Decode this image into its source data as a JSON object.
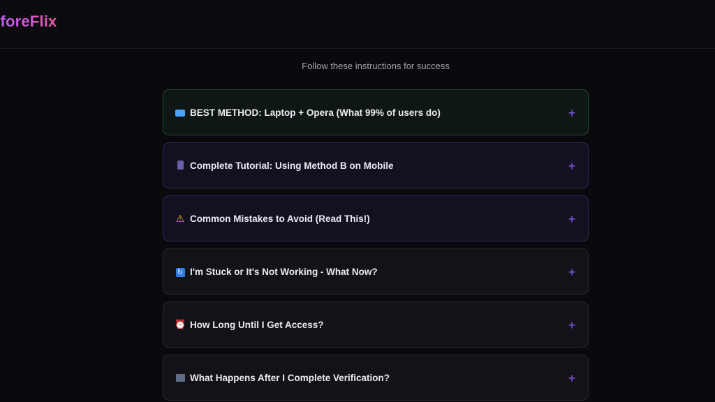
{
  "header": {
    "logo_text": "eforeFlix"
  },
  "page": {
    "subtitle": "Follow these instructions for success"
  },
  "faq": {
    "items": [
      {
        "icon": "laptop-icon",
        "question": "BEST METHOD: Laptop + Opera (What 99% of users do)",
        "toggle": "+"
      },
      {
        "icon": "mobile-phone-icon",
        "question": "Complete Tutorial: Using Method B on Mobile",
        "toggle": "+"
      },
      {
        "icon": "warning-icon",
        "question": "Common Mistakes to Avoid (Read This!)",
        "toggle": "+"
      },
      {
        "icon": "refresh-icon",
        "question": "I'm Stuck or It's Not Working - What Now?",
        "toggle": "+"
      },
      {
        "icon": "alarm-clock-icon",
        "question": "How Long Until I Get Access?",
        "toggle": "+"
      },
      {
        "icon": "clapperboard-icon",
        "question": "What Happens After I Complete Verification?",
        "toggle": "+"
      }
    ]
  },
  "colors": {
    "background": "#0a090d",
    "accent_plus": "#8a5cf5",
    "highlight_border_green": "#1f4a34",
    "highlight_border_purple": "#2f2a4f",
    "logo_gradient_start": "#b35cf0",
    "logo_gradient_end": "#e8579f"
  }
}
